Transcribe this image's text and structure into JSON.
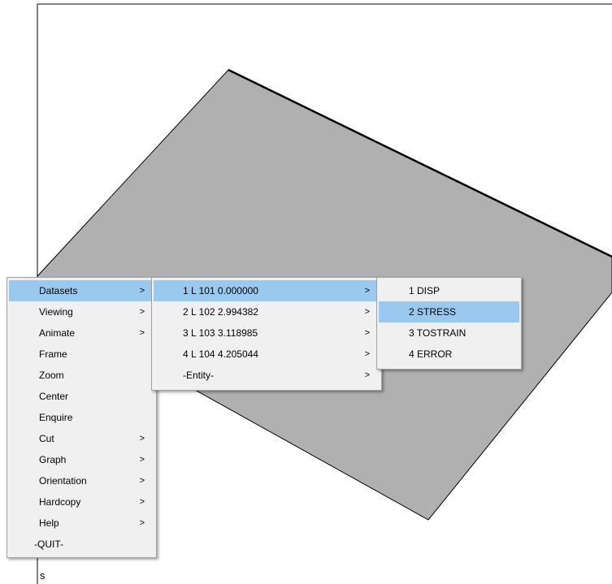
{
  "graphics": {
    "bottom_label": "s"
  },
  "main_menu": {
    "items": [
      {
        "label": "Datasets",
        "submenu": true,
        "highlighted": true
      },
      {
        "label": "Viewing",
        "submenu": true
      },
      {
        "label": "Animate",
        "submenu": true
      },
      {
        "label": "Frame",
        "submenu": false
      },
      {
        "label": "Zoom",
        "submenu": false
      },
      {
        "label": "Center",
        "submenu": false
      },
      {
        "label": "Enquire",
        "submenu": false
      },
      {
        "label": "Cut",
        "submenu": true
      },
      {
        "label": "Graph",
        "submenu": true
      },
      {
        "label": "Orientation",
        "submenu": true
      },
      {
        "label": "Hardcopy",
        "submenu": true
      },
      {
        "label": "Help",
        "submenu": true
      },
      {
        "label": "-QUIT-",
        "submenu": false
      }
    ]
  },
  "datasets_menu": {
    "items": [
      {
        "label": "1 L  101 0.000000",
        "submenu": true,
        "highlighted": true
      },
      {
        "label": "2 L  102 2.994382",
        "submenu": true
      },
      {
        "label": "3 L  103 3.118985",
        "submenu": true
      },
      {
        "label": "4 L  104 4.205044",
        "submenu": true
      },
      {
        "label": "-Entity-",
        "submenu": true
      }
    ]
  },
  "entity_menu": {
    "items": [
      {
        "label": "1 DISP"
      },
      {
        "label": "2 STRESS",
        "highlighted": true
      },
      {
        "label": "3 TOSTRAIN"
      },
      {
        "label": "4 ERROR"
      }
    ]
  },
  "arrow_glyph": ">",
  "colors": {
    "highlight": "#99c9ef",
    "menu_bg": "#f0f0f0",
    "shape_fill": "#b0b0b0"
  }
}
